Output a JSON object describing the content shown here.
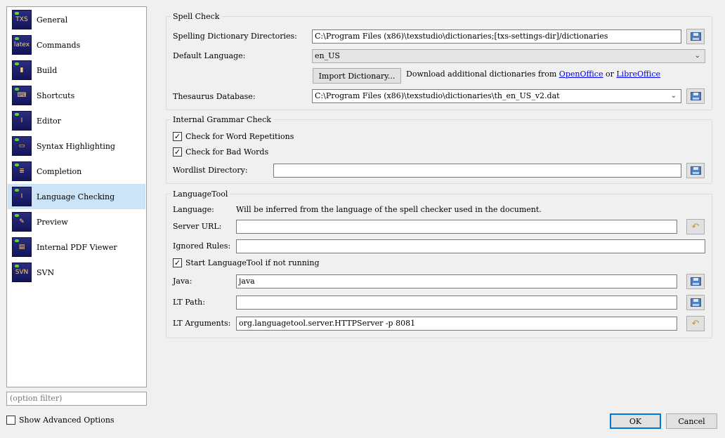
{
  "sidebar": {
    "items": [
      {
        "label": "General",
        "icon": "txs-icon",
        "glyph": "TXS",
        "selected": false
      },
      {
        "label": "Commands",
        "icon": "latex-icon",
        "glyph": "latex",
        "selected": false
      },
      {
        "label": "Build",
        "icon": "build-icon",
        "glyph": "▮",
        "selected": false
      },
      {
        "label": "Shortcuts",
        "icon": "keyboard-icon",
        "glyph": "⌨",
        "selected": false
      },
      {
        "label": "Editor",
        "icon": "editor-cursor-icon",
        "glyph": "I",
        "selected": false
      },
      {
        "label": "Syntax Highlighting",
        "icon": "syntax-highlighting-icon",
        "glyph": "▭",
        "selected": false
      },
      {
        "label": "Completion",
        "icon": "completion-icon",
        "glyph": "≣",
        "selected": false
      },
      {
        "label": "Language Checking",
        "icon": "language-checking-icon",
        "glyph": "I",
        "selected": true
      },
      {
        "label": "Preview",
        "icon": "preview-icon",
        "glyph": "✎",
        "selected": false
      },
      {
        "label": "Internal PDF Viewer",
        "icon": "pdf-viewer-icon",
        "glyph": "▤",
        "selected": false
      },
      {
        "label": "SVN",
        "icon": "svn-icon",
        "glyph": "SVN",
        "selected": false
      }
    ],
    "filter_placeholder": "(option filter)",
    "advanced_label": "Show Advanced Options",
    "advanced_checked": "☐"
  },
  "spell": {
    "title": "Spell Check",
    "dict_dirs_label": "Spelling Dictionary Directories:",
    "dict_dirs_value": "C:\\Program Files (x86)\\texstudio\\dictionaries;[txs-settings-dir]/dictionaries",
    "default_lang_label": "Default Language:",
    "default_lang_value": "en_US",
    "import_button": "Import Dictionary...",
    "download_text": "Download additional dictionaries from",
    "openoffice_link": "OpenOffice",
    "or_text": "or",
    "libreoffice_link": "LibreOffice",
    "thesaurus_label": "Thesaurus Database:",
    "thesaurus_value": "C:\\Program Files (x86)\\texstudio\\dictionaries\\th_en_US_v2.dat"
  },
  "grammar": {
    "title": "Internal Grammar Check",
    "word_repetitions_label": "Check for Word Repetitions",
    "bad_words_label": "Check for Bad Words",
    "check_mark": "✓",
    "wordlist_label": "Wordlist Directory:",
    "wordlist_value": ""
  },
  "languagetool": {
    "title": "LanguageTool",
    "language_label": "Language:",
    "language_value": "Will be inferred from the language of the spell checker used in the document.",
    "server_url_label": "Server URL:",
    "server_url_value": "",
    "ignored_rules_label": "Ignored Rules:",
    "ignored_rules_value": "",
    "start_label": "Start LanguageTool if not running",
    "java_label": "Java:",
    "java_value": "java",
    "lt_path_label": "LT Path:",
    "lt_path_value": "",
    "lt_args_label": "LT Arguments:",
    "lt_args_value": "org.languagetool.server.HTTPServer -p 8081"
  },
  "dialog": {
    "ok_label": "OK",
    "cancel_label": "Cancel"
  },
  "icons": {
    "browse_icon": "folder-browse-icon",
    "reset_icon": "reset-undo-icon",
    "chevron_icon": "chevron-down-icon",
    "undo_glyph": "↶",
    "chevron_glyph": "⌄"
  },
  "colors": {
    "selected_bg": "#cce4f7",
    "link": "#0000ee",
    "ok_border": "#0078d7"
  }
}
